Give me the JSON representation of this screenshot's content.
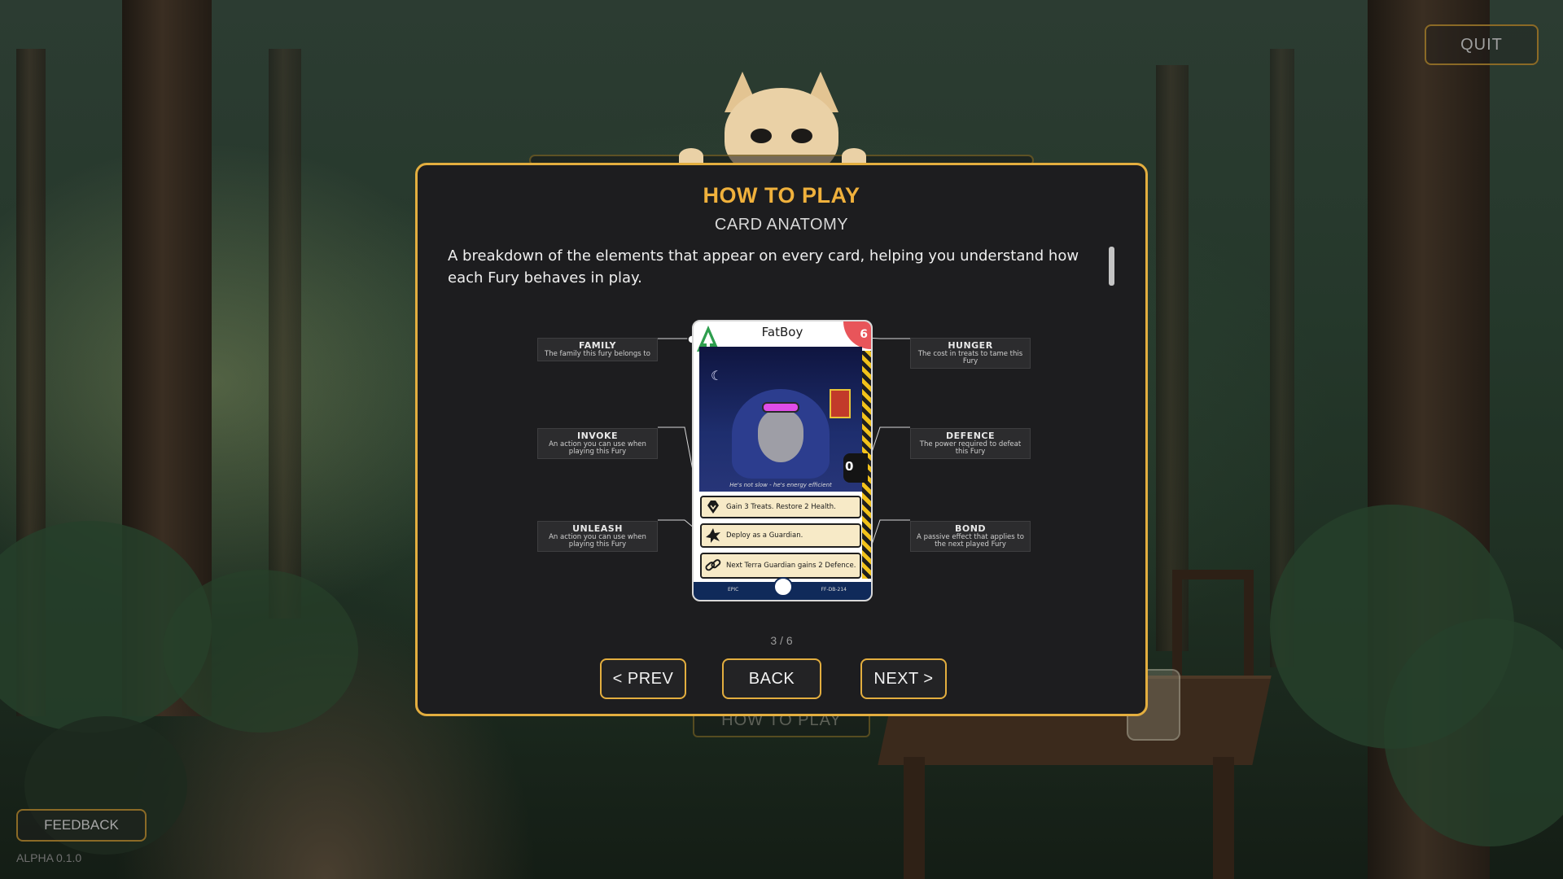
{
  "overlay": {
    "quit_label": "QUIT",
    "feedback_label": "FEEDBACK",
    "version": "ALPHA 0.1.0",
    "background_button_label": "HOW TO PLAY"
  },
  "modal": {
    "title": "HOW TO PLAY",
    "subtitle": "CARD ANATOMY",
    "description": "A breakdown of the elements that appear on every card, helping you understand how each Fury behaves in play.",
    "page_indicator": "3 / 6",
    "prev_label": "< PREV",
    "back_label": "BACK",
    "next_label": "NEXT >",
    "accent_color": "#e3ae3f"
  },
  "annotations": {
    "family": {
      "title": "FAMILY",
      "desc": "The family this fury belongs to"
    },
    "invoke": {
      "title": "INVOKE",
      "desc": "An action you can use when playing this Fury"
    },
    "unleash": {
      "title": "UNLEASH",
      "desc": "An action you can use when playing this Fury"
    },
    "hunger": {
      "title": "HUNGER",
      "desc": "The cost in treats to tame this Fury"
    },
    "defence": {
      "title": "DEFENCE",
      "desc": "The power required to defeat this Fury"
    },
    "bond": {
      "title": "BOND",
      "desc": "A passive effect that applies to the next played Fury"
    }
  },
  "card": {
    "name": "FatBoy",
    "hunger": "6",
    "defence": "0",
    "flavor": "He's not slow - he's energy efficient",
    "invoke_text": "Gain 3 Treats. Restore 2 Health.",
    "unleash_text": "Deploy as a Guardian.",
    "bond_text": "Next Terra Guardian gains 2 Defence.",
    "rarity": "EPIC",
    "set_code": "FF-DB-214",
    "family_icon": "tree-icon",
    "family_color": "#2e9e4e"
  }
}
